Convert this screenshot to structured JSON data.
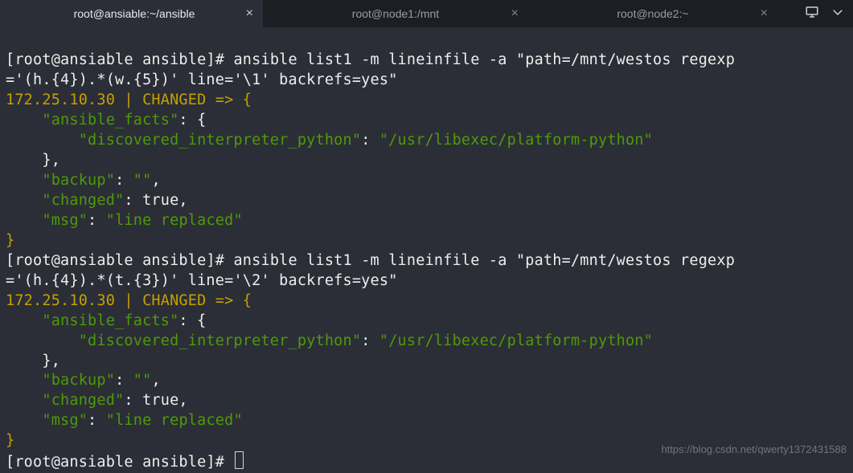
{
  "tabs": [
    {
      "title": "root@ansiable:~/ansible",
      "close": "×",
      "active": true
    },
    {
      "title": "root@node1:/mnt",
      "close": "×",
      "active": false
    },
    {
      "title": "root@node2:~",
      "close": "×",
      "active": false
    }
  ],
  "prompt1": {
    "bracket_open": "[",
    "user_host": "root@ansiable ansible",
    "bracket_close": "]# ",
    "cmd": "ansible list1 -m lineinfile -a \"path=/mnt/westos regexp\n='(h.{4}).*(w.{5})' line='\\1' backrefs=yes\""
  },
  "result1": {
    "header_ip": "172.25.10.30 | ",
    "header_status": "CHANGED",
    "header_arrow": " => {",
    "line_facts_key": "    \"ansible_facts\"",
    "line_facts_colon": ": {",
    "line_discov_key": "        \"discovered_interpreter_python\"",
    "line_discov_colon": ": ",
    "line_discov_val": "\"/usr/libexec/platform-python\"",
    "line_close_facts": "    },",
    "line_backup_key": "    \"backup\"",
    "line_backup_colon": ": ",
    "line_backup_val": "\"\"",
    "line_backup_comma": ",",
    "line_changed_key": "    \"changed\"",
    "line_changed_colon": ": true,",
    "line_msg_key": "    \"msg\"",
    "line_msg_colon": ": ",
    "line_msg_val": "\"line replaced\"",
    "line_close": "}"
  },
  "prompt2": {
    "bracket_open": "[",
    "user_host": "root@ansiable ansible",
    "bracket_close": "]# ",
    "cmd": "ansible list1 -m lineinfile -a \"path=/mnt/westos regexp\n='(h.{4}).*(t.{3})' line='\\2' backrefs=yes\""
  },
  "result2": {
    "header_ip": "172.25.10.30 | ",
    "header_status": "CHANGED",
    "header_arrow": " => {",
    "line_facts_key": "    \"ansible_facts\"",
    "line_facts_colon": ": {",
    "line_discov_key": "        \"discovered_interpreter_python\"",
    "line_discov_colon": ": ",
    "line_discov_val": "\"/usr/libexec/platform-python\"",
    "line_close_facts": "    },",
    "line_backup_key": "    \"backup\"",
    "line_backup_colon": ": ",
    "line_backup_val": "\"\"",
    "line_backup_comma": ",",
    "line_changed_key": "    \"changed\"",
    "line_changed_colon": ": true,",
    "line_msg_key": "    \"msg\"",
    "line_msg_colon": ": ",
    "line_msg_val": "\"line replaced\"",
    "line_close": "}"
  },
  "prompt3": {
    "bracket_open": "[",
    "user_host": "root@ansiable ansible",
    "bracket_close": "]# "
  },
  "watermark": "https://blog.csdn.net/qwerty1372431588"
}
